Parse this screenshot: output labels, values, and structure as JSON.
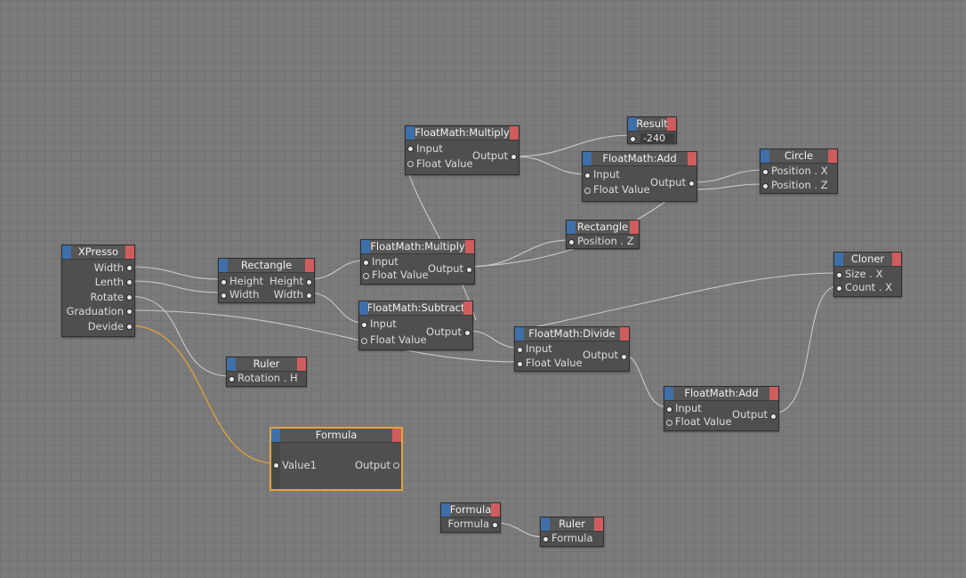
{
  "nodes": {
    "xpresso": {
      "title": "XPresso",
      "outputs": [
        "Width",
        "Lenth",
        "Rotate",
        "Graduation",
        "Devide"
      ]
    },
    "rect1": {
      "title": "Rectangle",
      "inputs": [
        "Height",
        "Width"
      ],
      "outputs": [
        "Height",
        "Width"
      ]
    },
    "ruler1": {
      "title": "Ruler",
      "inputs": [
        "Rotation . H"
      ]
    },
    "formula_big": {
      "title": "Formula",
      "input": "Value1",
      "output": "Output"
    },
    "fm_mul1": {
      "title": "FloatMath:Multiply",
      "inputs": [
        "Input",
        "Float Value"
      ],
      "output": "Output"
    },
    "fm_mul2": {
      "title": "FloatMath:Multiply",
      "inputs": [
        "Input",
        "Float Value"
      ],
      "output": "Output"
    },
    "fm_sub": {
      "title": "FloatMath:Subtract",
      "inputs": [
        "Input",
        "Float Value"
      ],
      "output": "Output"
    },
    "result": {
      "title": "Result",
      "value": "-240"
    },
    "fm_add1": {
      "title": "FloatMath:Add",
      "inputs": [
        "Input",
        "Float Value"
      ],
      "output": "Output"
    },
    "circle": {
      "title": "Circle",
      "inputs": [
        "Position . X",
        "Position . Z"
      ]
    },
    "rect2": {
      "title": "Rectangle",
      "inputs": [
        "Position . Z"
      ]
    },
    "cloner": {
      "title": "Cloner",
      "inputs": [
        "Size . X",
        "Count . X"
      ]
    },
    "fm_div": {
      "title": "FloatMath:Divide",
      "inputs": [
        "Input",
        "Float Value"
      ],
      "output": "Output"
    },
    "fm_add2": {
      "title": "FloatMath:Add",
      "inputs": [
        "Input",
        "Float Value"
      ],
      "output": "Output"
    },
    "formula_small": {
      "title": "Formula",
      "output": "Formula"
    },
    "ruler2": {
      "title": "Ruler",
      "inputs": [
        "Formula"
      ]
    }
  },
  "colors": {
    "background": "#7b7b7b",
    "node_body": "#4f4f4f",
    "header_left": "#3f6fa8",
    "header_right": "#cf5d5d",
    "wire": "#c9c9c9",
    "selected": "#e3a33c"
  },
  "selected_node": "formula_big"
}
